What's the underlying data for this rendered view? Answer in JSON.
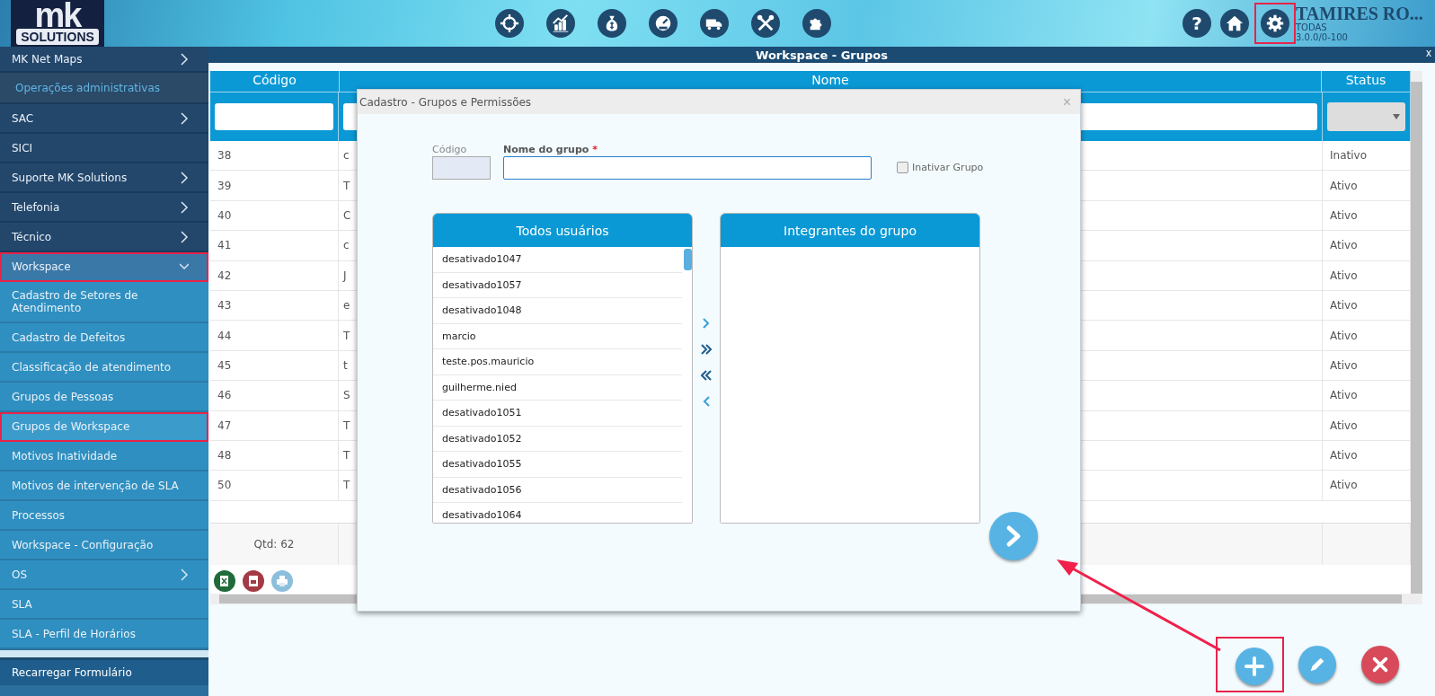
{
  "logo": {
    "mark": "mk",
    "name": "SOLUTIONS"
  },
  "toolbar": {
    "modules": [
      {
        "kind": "crosshair"
      },
      {
        "kind": "chart"
      },
      {
        "kind": "money"
      },
      {
        "kind": "gauge"
      },
      {
        "kind": "truck"
      },
      {
        "kind": "tools"
      },
      {
        "kind": "puzzle"
      }
    ],
    "help_label": "?",
    "settings_highlighted": true
  },
  "user": {
    "name": "TAMIRES RO...",
    "company": "TODAS",
    "version": "3.0.0/0-100"
  },
  "sidebar": {
    "items": [
      {
        "kind": "item",
        "label": "MK Net Maps",
        "submenu": true,
        "expanded": false,
        "highlighted": false
      },
      {
        "kind": "section",
        "label": "Operações administrativas"
      },
      {
        "kind": "item",
        "label": "SAC",
        "submenu": true,
        "expanded": false,
        "highlighted": false
      },
      {
        "kind": "item",
        "label": "SICI",
        "submenu": false,
        "highlighted": false
      },
      {
        "kind": "item",
        "label": "Suporte MK Solutions",
        "submenu": true,
        "expanded": false,
        "highlighted": false
      },
      {
        "kind": "item",
        "label": "Telefonia",
        "submenu": true,
        "expanded": false,
        "highlighted": false
      },
      {
        "kind": "item",
        "label": "Técnico",
        "submenu": true,
        "expanded": false,
        "highlighted": false
      },
      {
        "kind": "item",
        "label": "Workspace",
        "submenu": true,
        "expanded": true,
        "highlighted": true,
        "children": [
          {
            "label": "Cadastro de Setores de Atendimento",
            "selected": false
          },
          {
            "label": "Cadastro de Defeitos",
            "selected": false
          },
          {
            "label": "Classificação de atendimento",
            "selected": false
          },
          {
            "label": "Grupos de Pessoas",
            "selected": false
          },
          {
            "label": "Grupos de Workspace",
            "selected": true
          },
          {
            "label": "Motivos Inatividade",
            "selected": false
          },
          {
            "label": "Motivos de intervenção de SLA",
            "selected": false
          },
          {
            "label": "Processos",
            "selected": false
          },
          {
            "label": "Workspace - Configuração",
            "selected": false
          }
        ]
      },
      {
        "kind": "child",
        "label": "OS",
        "submenu": true,
        "expanded": false,
        "highlighted": false
      },
      {
        "kind": "child",
        "label": "SLA",
        "submenu": false,
        "highlighted": false
      },
      {
        "kind": "child",
        "label": "SLA - Perfil de Horários",
        "submenu": false,
        "highlighted": false
      }
    ],
    "reload": "Recarregar Formulário"
  },
  "panel": {
    "title": "Workspace - Grupos",
    "close": "x"
  },
  "table": {
    "columns": [
      "Código",
      "Nome",
      "Status"
    ],
    "rows": [
      {
        "code": "38",
        "name": "c",
        "status": "Inativo"
      },
      {
        "code": "39",
        "name": "T",
        "status": "Ativo"
      },
      {
        "code": "40",
        "name": "C",
        "status": "Ativo"
      },
      {
        "code": "41",
        "name": "c",
        "status": "Ativo"
      },
      {
        "code": "42",
        "name": "J",
        "status": "Ativo"
      },
      {
        "code": "43",
        "name": "e",
        "status": "Ativo"
      },
      {
        "code": "44",
        "name": "T",
        "status": "Ativo"
      },
      {
        "code": "45",
        "name": "t",
        "status": "Ativo"
      },
      {
        "code": "46",
        "name": "S",
        "status": "Ativo"
      },
      {
        "code": "47",
        "name": "T",
        "status": "Ativo"
      },
      {
        "code": "48",
        "name": "T",
        "status": "Ativo"
      },
      {
        "code": "50",
        "name": "T",
        "status": "Ativo"
      }
    ],
    "count": "Qtd: 62"
  },
  "dialog": {
    "title": "Cadastro - Grupos e Permissões",
    "close": "×",
    "code_label": "Código",
    "name_label": "Nome do grupo",
    "required_mark": "*",
    "inactive": {
      "label": "Inativar Grupo",
      "checked": false
    },
    "all_users": {
      "title": "Todos usuários",
      "items": [
        "desativado1047",
        "desativado1057",
        "desativado1048",
        "marcio",
        "teste.pos.mauricio",
        "guilherme.nied",
        "desativado1051",
        "desativado1052",
        "desativado1055",
        "desativado1056",
        "desativado1064"
      ]
    },
    "members": {
      "title": "Integrantes do grupo"
    }
  },
  "actions": {
    "add_highlighted": true
  }
}
